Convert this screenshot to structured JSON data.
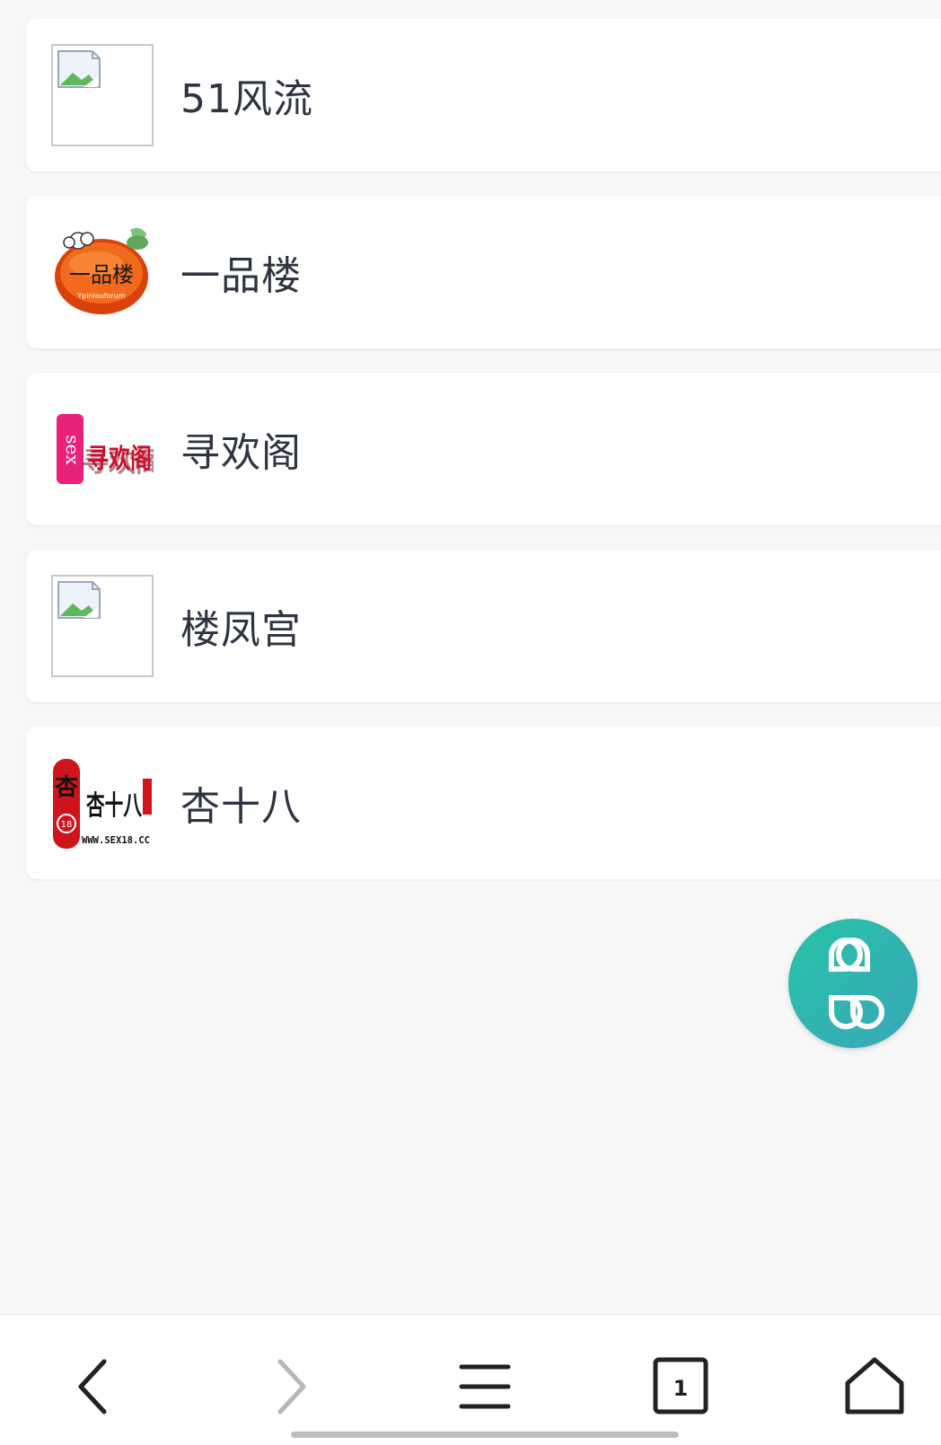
{
  "items": [
    {
      "title": "51风流",
      "icon": "broken-image-icon"
    },
    {
      "title": "一品楼",
      "icon": "yipinlou-logo",
      "logo_text": "一品楼",
      "logo_subtext": "Ypinlouforum"
    },
    {
      "title": "寻欢阁",
      "icon": "xunhuange-logo",
      "logo_text": "寻欢阁"
    },
    {
      "title": "楼凤宫",
      "icon": "broken-image-icon"
    },
    {
      "title": "杏十八",
      "icon": "xingshiba-logo",
      "logo_text": "杏十八",
      "logo_url": "WWW.SEX18.CC"
    }
  ],
  "fab": {
    "icon": "clover-apps-icon",
    "color": "#2fb6b0"
  },
  "navbar": {
    "back_icon": "chevron-left-icon",
    "forward_icon": "chevron-right-icon",
    "menu_icon": "hamburger-menu-icon",
    "tabs_count": "1",
    "home_icon": "home-icon"
  }
}
